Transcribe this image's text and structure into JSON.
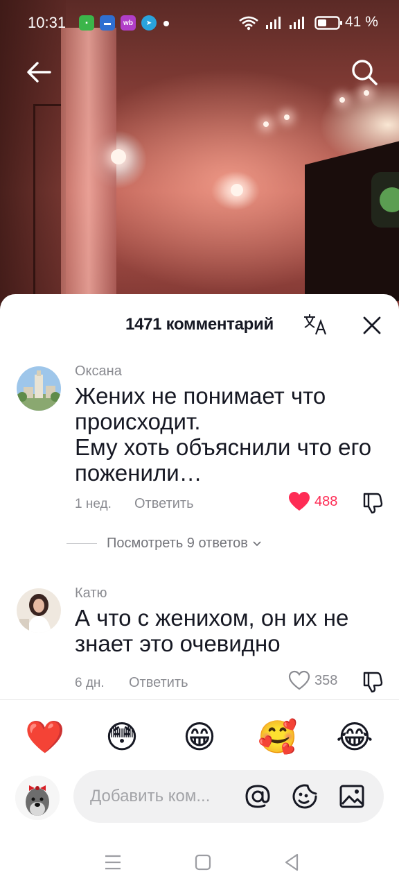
{
  "status_bar": {
    "time": "10:31",
    "battery": "41 %",
    "app_icons": [
      {
        "name": "tv-app-icon",
        "label": "",
        "color": "#3bb54a"
      },
      {
        "name": "bus-app-icon",
        "label": "",
        "color": "#2f6fd1"
      },
      {
        "name": "wb-app-icon",
        "label": "wb",
        "color": "#b13ec8"
      },
      {
        "name": "telegram-app-icon",
        "label": "",
        "color": "#2aa3dd"
      }
    ]
  },
  "sheet": {
    "title": "1471 комментарий"
  },
  "comments": [
    {
      "author": "Оксана",
      "text": "Жених не понимает что происходит.\nЕму хоть объяснили что его поженили…",
      "time": "1 нед.",
      "reply_label": "Ответить",
      "likes": "488",
      "liked": true,
      "view_replies": "Посмотреть 9 ответов"
    },
    {
      "author": "Катю",
      "text": "А что с женихом, он их не знает это очевидно",
      "time": "6 дн.",
      "reply_label": "Ответить",
      "likes": "358",
      "liked": false
    }
  ],
  "emoji_bar": [
    "❤️",
    "😳",
    "😁",
    "🥰",
    "😂"
  ],
  "input": {
    "placeholder": "Добавить ком..."
  },
  "colors": {
    "like_red": "#fe2c55",
    "text_gray": "#8a8b91"
  }
}
